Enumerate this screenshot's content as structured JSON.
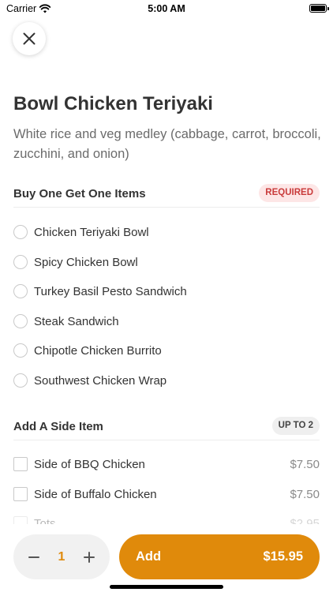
{
  "status_bar": {
    "carrier": "Carrier",
    "time": "5:00 AM"
  },
  "item": {
    "title": "Bowl Chicken Teriyaki",
    "description": "White rice and veg medley (cabbage, carrot, broccoli, zucchini, and onion)"
  },
  "sections": [
    {
      "title": "Buy One Get One Items",
      "badge": "REQUIRED",
      "options": [
        {
          "label": "Chicken Teriyaki Bowl"
        },
        {
          "label": "Spicy Chicken Bowl"
        },
        {
          "label": "Turkey Basil Pesto Sandwich"
        },
        {
          "label": "Steak Sandwich"
        },
        {
          "label": "Chipotle Chicken Burrito"
        },
        {
          "label": "Southwest Chicken Wrap"
        }
      ]
    },
    {
      "title": "Add A Side Item",
      "badge": "UP TO 2",
      "options": [
        {
          "label": "Side of BBQ Chicken",
          "price": "$7.50"
        },
        {
          "label": "Side of Buffalo Chicken",
          "price": "$7.50"
        },
        {
          "label": "Tots",
          "price": "$2.95"
        }
      ]
    }
  ],
  "cart": {
    "quantity": "1",
    "add_label": "Add",
    "total": "$15.95"
  },
  "colors": {
    "accent": "#e08a0b",
    "required_bg": "#fde6e6",
    "required_text": "#c93b3b"
  }
}
